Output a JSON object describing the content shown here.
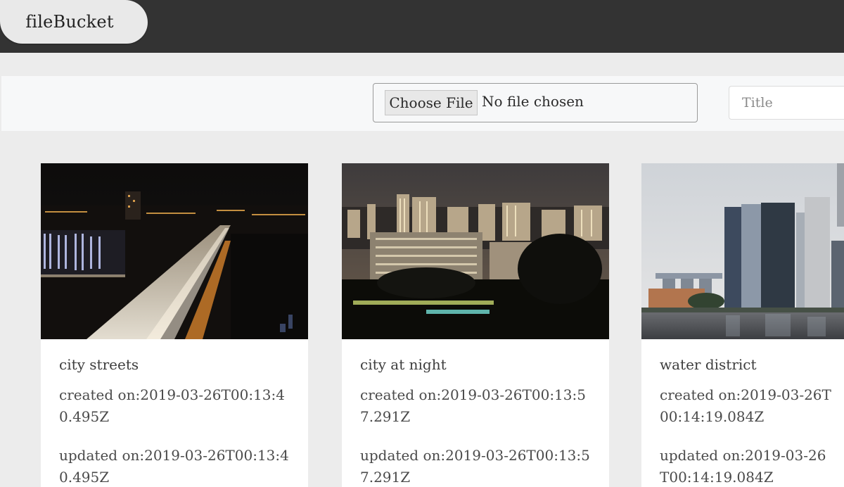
{
  "header": {
    "brand": "fileBucket"
  },
  "upload": {
    "choose_label": "Choose File",
    "no_file_label": "No file chosen",
    "title_placeholder": "Title",
    "title_value": ""
  },
  "cards": [
    {
      "title": "city streets",
      "created_label": "created on:",
      "created": "2019-03-26T00:13:40.495Z",
      "updated_label": "updated on:",
      "updated": "2019-03-26T00:13:40.495Z",
      "image": "city-streets-night-photo"
    },
    {
      "title": "city at night",
      "created_label": "created on:",
      "created": "2019-03-26T00:13:57.291Z",
      "updated_label": "updated on:",
      "updated": "2019-03-26T00:13:57.291Z",
      "image": "city-night-skyline-photo"
    },
    {
      "title": "water district",
      "created_label": "created on:",
      "created": "2019-03-26T00:14:19.084Z",
      "updated_label": "updated on:",
      "updated": "2019-03-26T00:14:19.084Z",
      "image": "waterfront-skyline-photo"
    }
  ]
}
